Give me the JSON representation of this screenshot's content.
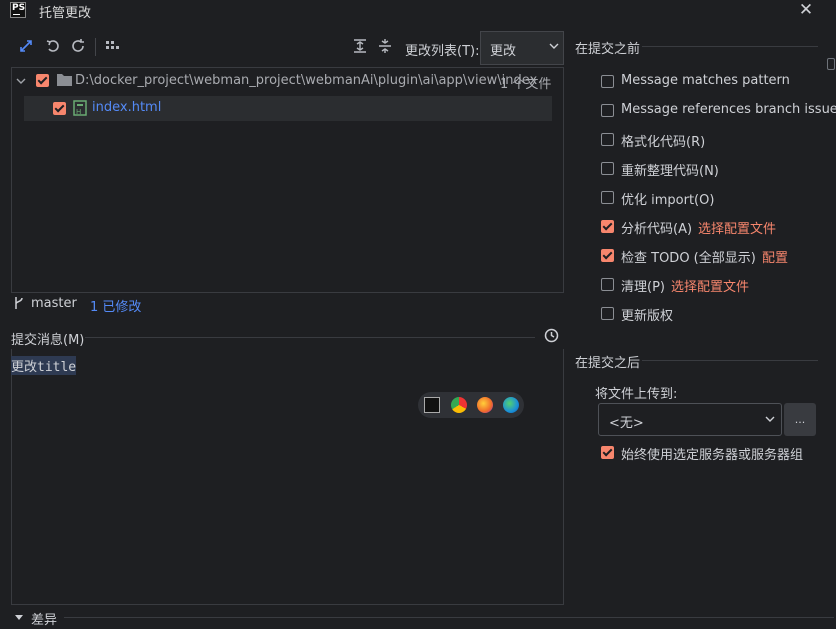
{
  "window": {
    "title": "托管更改",
    "logo_text": "PS",
    "close_symbol": "✕"
  },
  "toolbar": {
    "changelist_label": "更改列表(T):",
    "changelist_value": "更改"
  },
  "tree": {
    "root_path": "D:\\docker_project\\webman_project\\webmanAi\\plugin\\ai\\app\\view\\index",
    "root_count": "1 个文件",
    "file_name": "index.html"
  },
  "branch": {
    "name": "master",
    "modified": "1 已修改"
  },
  "commit_message": {
    "label": "提交消息(M)",
    "text": "更改title"
  },
  "before_commit": {
    "heading": "在提交之前",
    "options": [
      {
        "label": "Message matches pattern",
        "checked": false,
        "link": ""
      },
      {
        "label": "Message references branch issue",
        "checked": false,
        "link": ""
      },
      {
        "label": "格式化代码(R)",
        "checked": false,
        "link": ""
      },
      {
        "label": "重新整理代码(N)",
        "checked": false,
        "link": ""
      },
      {
        "label": "优化 import(O)",
        "checked": false,
        "link": ""
      },
      {
        "label": "分析代码(A)",
        "checked": true,
        "link": "选择配置文件"
      },
      {
        "label": "检查 TODO (全部显示)",
        "checked": true,
        "link": "配置"
      },
      {
        "label": "清理(P)",
        "checked": false,
        "link": "选择配置文件"
      },
      {
        "label": "更新版权",
        "checked": false,
        "link": ""
      }
    ]
  },
  "after_commit": {
    "heading": "在提交之后",
    "upload_label": "将文件上传到:",
    "upload_value": "<无>",
    "more_label": "...",
    "always_use": "始终使用选定服务器或服务器组"
  },
  "diff": {
    "label": "差异"
  },
  "colors": {
    "accent": "#f7866d",
    "link_blue": "#548af7",
    "bg": "#1e1f22"
  }
}
